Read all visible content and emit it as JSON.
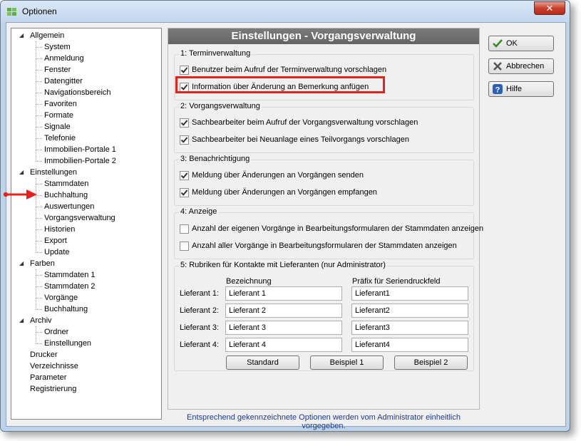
{
  "window": {
    "title": "Optionen"
  },
  "tree": {
    "groups": [
      {
        "label": "Allgemein",
        "children": [
          "System",
          "Anmeldung",
          "Fenster",
          "Datengitter",
          "Navigationsbereich",
          "Favoriten",
          "Formate",
          "Signale",
          "Telefonie",
          "Immobilien-Portale 1",
          "Immobilien-Portale 2"
        ]
      },
      {
        "label": "Einstellungen",
        "children": [
          "Stammdaten",
          "Buchhaltung",
          "Auswertungen",
          "Vorgangsverwaltung",
          "Historien",
          "Export",
          "Update"
        ]
      },
      {
        "label": "Farben",
        "children": [
          "Stammdaten 1",
          "Stammdaten 2",
          "Vorgänge",
          "Buchhaltung"
        ]
      },
      {
        "label": "Archiv",
        "children": [
          "Ordner",
          "Einstellungen"
        ]
      }
    ],
    "leaves": [
      "Drucker",
      "Verzeichnisse",
      "Parameter",
      "Registrierung"
    ],
    "selected": "Vorgangsverwaltung"
  },
  "panel": {
    "title": "Einstellungen - Vorgangsverwaltung",
    "termin": {
      "label": "1: Terminverwaltung",
      "items": [
        {
          "label": "Benutzer beim Aufruf der Terminverwaltung vorschlagen",
          "checked": true
        },
        {
          "label": "Information über Änderung an Bemerkung anfügen",
          "checked": true
        }
      ]
    },
    "vorgang": {
      "label": "2: Vorgangsverwaltung",
      "items": [
        {
          "label": "Sachbearbeiter beim Aufruf der Vorgangsverwaltung vorschlagen",
          "checked": true
        },
        {
          "label": "Sachbearbeiter bei Neuanlage eines Teilvorgangs vorschlagen",
          "checked": true
        }
      ]
    },
    "benachrichtigung": {
      "label": "3: Benachrichtigung",
      "items": [
        {
          "label": "Meldung über Änderungen an Vorgängen senden",
          "checked": true
        },
        {
          "label": "Meldung über Änderungen an Vorgängen empfangen",
          "checked": true
        }
      ]
    },
    "anzeige": {
      "label": "4: Anzeige",
      "items": [
        {
          "label": "Anzahl der eigenen Vorgänge in Bearbeitungsformularen der Stammdaten anzeigen",
          "checked": false
        },
        {
          "label": "Anzahl aller Vorgänge in Bearbeitungsformularen der Stammdaten anzeigen",
          "checked": false
        }
      ]
    },
    "rubriken": {
      "label": "5: Rubriken für Kontakte mit Lieferanten  (nur Administrator)",
      "col_name": "Bezeichnung",
      "col_prefix": "Präfix für Seriendruckfeld",
      "rows": [
        {
          "label": "Lieferant 1:",
          "name": "Lieferant 1",
          "prefix": "Lieferant1"
        },
        {
          "label": "Lieferant 2:",
          "name": "Lieferant 2",
          "prefix": "Lieferant2"
        },
        {
          "label": "Lieferant 3:",
          "name": "Lieferant 3",
          "prefix": "Lieferant3"
        },
        {
          "label": "Lieferant 4:",
          "name": "Lieferant 4",
          "prefix": "Lieferant4"
        }
      ],
      "buttons": [
        "Standard",
        "Beispiel 1",
        "Beispiel 2"
      ]
    }
  },
  "footer": "Entsprechend gekennzeichnete Optionen werden vom Administrator einheitlich vorgegeben.",
  "actions": {
    "ok": "OK",
    "cancel": "Abbrechen",
    "help": "Hilfe"
  },
  "colors": {
    "highlight": "#e8201a",
    "header": "#6e6e6e",
    "footer_text": "#1f3a93"
  }
}
